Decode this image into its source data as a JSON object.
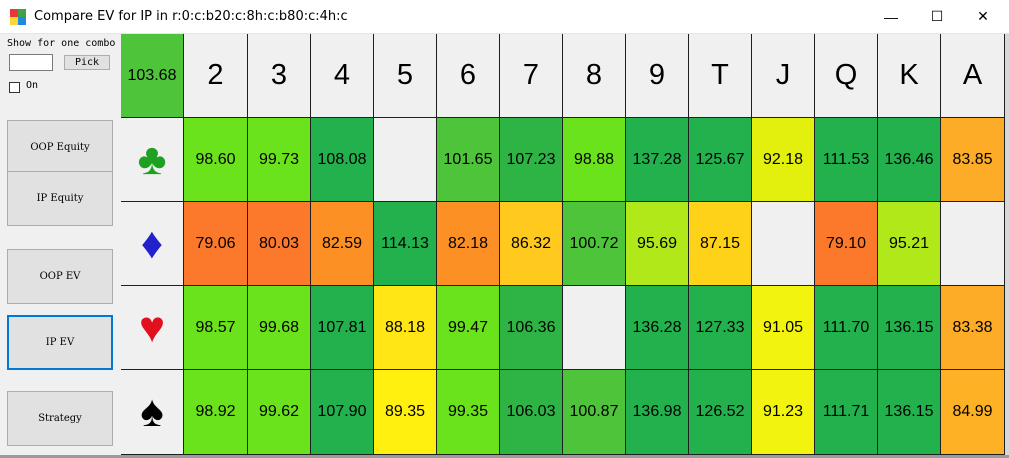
{
  "window": {
    "title": "Compare EV for IP in r:0:c:b20:c:8h:c:b80:c:4h:c",
    "minimize_glyph": "—",
    "maximize_glyph": "☐",
    "close_glyph": "✕"
  },
  "sidebar": {
    "show_label": "Show for one combo",
    "combo_value": "",
    "pick_label": "Pick",
    "on_label": "On",
    "on_checked": false,
    "buttons": [
      {
        "label": "OOP Equity",
        "active": false
      },
      {
        "label": "IP Equity",
        "active": false
      },
      {
        "label": "OOP EV",
        "active": false
      },
      {
        "label": "IP EV",
        "active": true
      },
      {
        "label": "Strategy",
        "active": false
      }
    ]
  },
  "grid": {
    "corner_value": "103.68",
    "ranks": [
      "2",
      "3",
      "4",
      "5",
      "6",
      "7",
      "8",
      "9",
      "T",
      "J",
      "Q",
      "K",
      "A"
    ],
    "suits": [
      {
        "name": "clubs",
        "glyph": "♣",
        "color": "#1ea020",
        "icon": "club-icon"
      },
      {
        "name": "diamonds",
        "glyph": "♦",
        "color": "#2222cc",
        "icon": "diamond-icon"
      },
      {
        "name": "hearts",
        "glyph": "♥",
        "color": "#e0101e",
        "icon": "heart-icon"
      },
      {
        "name": "spades",
        "glyph": "♠",
        "color": "#000000",
        "icon": "spade-icon"
      }
    ],
    "rows": [
      [
        "98.60",
        "99.73",
        "108.08",
        "",
        "101.65",
        "107.23",
        "98.88",
        "137.28",
        "125.67",
        "92.18",
        "111.53",
        "136.46",
        "83.85"
      ],
      [
        "79.06",
        "80.03",
        "82.59",
        "114.13",
        "82.18",
        "86.32",
        "100.72",
        "95.69",
        "87.15",
        "",
        "79.10",
        "95.21",
        ""
      ],
      [
        "98.57",
        "99.68",
        "107.81",
        "88.18",
        "99.47",
        "106.36",
        "",
        "136.28",
        "127.33",
        "91.05",
        "111.70",
        "136.15",
        "83.38"
      ],
      [
        "98.92",
        "99.62",
        "107.90",
        "89.35",
        "99.35",
        "106.03",
        "100.87",
        "136.98",
        "126.52",
        "91.23",
        "111.71",
        "136.15",
        "84.99"
      ]
    ],
    "colors": [
      [
        "#6ae21c",
        "#6ae21c",
        "#22b14c",
        "#f0f0f0",
        "#4ec43a",
        "#2db445",
        "#6ae21c",
        "#22b14c",
        "#22b14c",
        "#e3f00e",
        "#22b14c",
        "#22b14c",
        "#fcac26"
      ],
      [
        "#fc782a",
        "#fc782a",
        "#fc9024",
        "#22b14c",
        "#fc9024",
        "#ffc91e",
        "#4ec43a",
        "#b0e81a",
        "#ffd21a",
        "#f0f0f0",
        "#fc782a",
        "#b0e81a",
        "#f0f0f0"
      ],
      [
        "#6ae21c",
        "#6ae21c",
        "#22b14c",
        "#ffe614",
        "#6ae21c",
        "#2db445",
        "#f0f0f0",
        "#22b14c",
        "#22b14c",
        "#f2f410",
        "#22b14c",
        "#22b14c",
        "#fcac26"
      ],
      [
        "#6ae21c",
        "#6ae21c",
        "#22b14c",
        "#fff010",
        "#6ae21c",
        "#2db445",
        "#4ec43a",
        "#22b14c",
        "#22b14c",
        "#f2f410",
        "#22b14c",
        "#22b14c",
        "#fcb224"
      ]
    ]
  }
}
